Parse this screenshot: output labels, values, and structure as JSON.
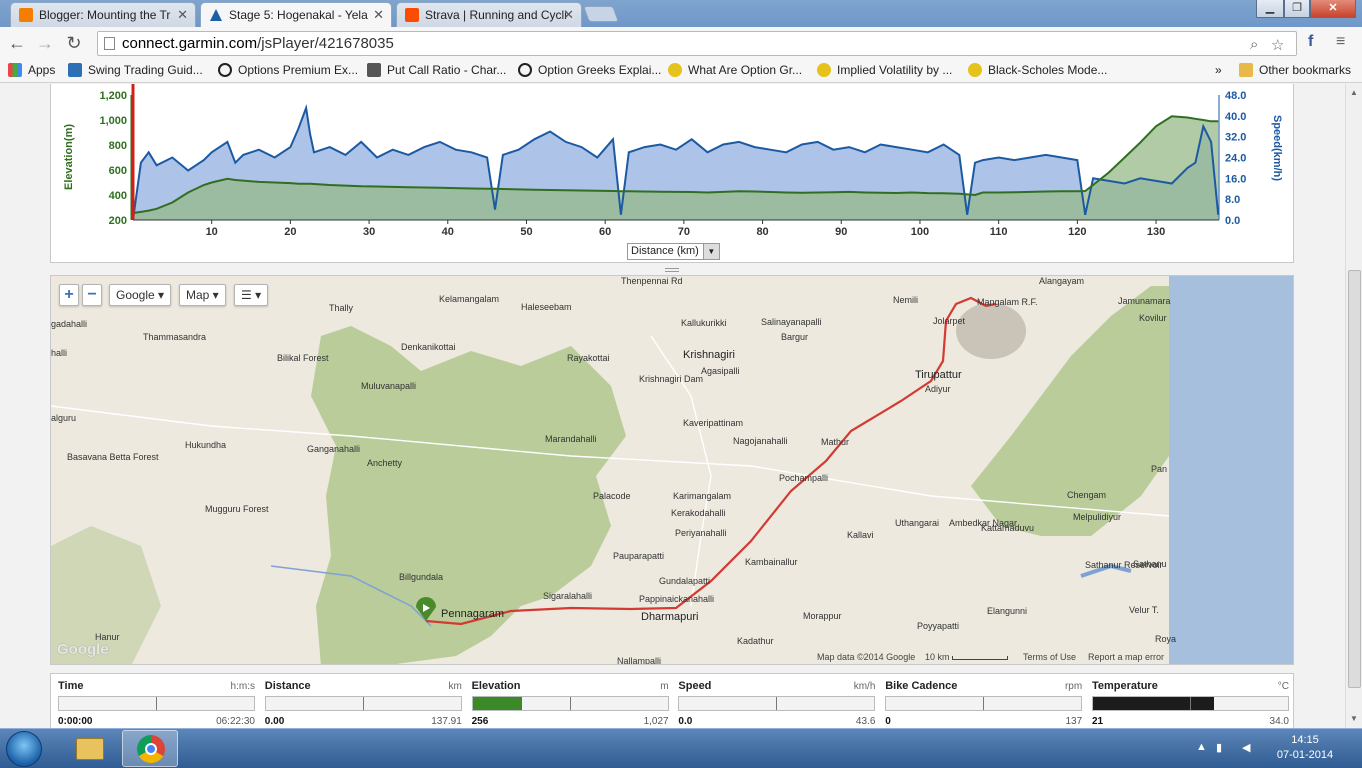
{
  "browser": {
    "tabs": [
      {
        "label": "Blogger: Mounting the Tr",
        "icon": "blogger-icon",
        "color": "#f57d00"
      },
      {
        "label": "Stage 5: Hogenakal - Yela",
        "icon": "garmin-icon",
        "color": "#1a5fa8"
      },
      {
        "label": "Strava | Running and Cycli",
        "icon": "strava-icon",
        "color": "#fc4c02"
      }
    ],
    "url_host": "connect.garmin.com",
    "url_path": "/jsPlayer/421678035",
    "bookmarks": [
      {
        "label": "Apps",
        "icon": "apps-grid-icon"
      },
      {
        "label": "Swing Trading Guid...",
        "icon": "bookmark-page-icon"
      },
      {
        "label": "Options Premium Ex...",
        "icon": "bookmark-o-icon"
      },
      {
        "label": "Put Call Ratio - Char...",
        "icon": "bookmark-chart-icon"
      },
      {
        "label": "Option Greeks Explai...",
        "icon": "bookmark-o-icon"
      },
      {
        "label": "What Are Option Gr...",
        "icon": "bookmark-smiley-icon"
      },
      {
        "label": "Implied Volatility by ...",
        "icon": "bookmark-smiley-icon"
      },
      {
        "label": "Black-Scholes Mode...",
        "icon": "bookmark-smiley-icon"
      }
    ],
    "more_bookmarks": "»",
    "other_bookmarks": "Other bookmarks"
  },
  "chart": {
    "left_axis_title": "Elevation(m)",
    "right_axis_title": "Speed(km/h)",
    "distance_select": "Distance (km)"
  },
  "chart_data": {
    "type": "area",
    "x": [
      0,
      1,
      2,
      3,
      5,
      7,
      9,
      10,
      12,
      13,
      14,
      16,
      18,
      20,
      21,
      22,
      22.5,
      23,
      25,
      27,
      29,
      31,
      33,
      35,
      37,
      39,
      41,
      43,
      45,
      46,
      47,
      49,
      51,
      53,
      55,
      57,
      59,
      61,
      62,
      63,
      65,
      67,
      69,
      71,
      73,
      75,
      77,
      79,
      81,
      83,
      85,
      87,
      89,
      91,
      93,
      95,
      97,
      99,
      101,
      103,
      105,
      106,
      107,
      108,
      110,
      112,
      114,
      116,
      118,
      120,
      121,
      122,
      124,
      126,
      128,
      130,
      132,
      134,
      135,
      136,
      137,
      137.9
    ],
    "xlim": [
      0,
      138
    ],
    "xticks": [
      10,
      20,
      30,
      40,
      50,
      60,
      70,
      80,
      90,
      100,
      110,
      120,
      130
    ],
    "series": [
      {
        "name": "Elevation(m)",
        "unit": "m",
        "color": "#2f6f1f",
        "fill": "#97b98a",
        "values": [
          256,
          265,
          275,
          290,
          340,
          420,
          480,
          500,
          530,
          520,
          515,
          505,
          500,
          495,
          490,
          490,
          490,
          488,
          480,
          475,
          470,
          468,
          465,
          462,
          460,
          458,
          455,
          452,
          450,
          450,
          448,
          445,
          442,
          440,
          438,
          436,
          434,
          432,
          430,
          430,
          428,
          426,
          425,
          424,
          420,
          425,
          430,
          428,
          424,
          420,
          418,
          420,
          422,
          425,
          420,
          418,
          416,
          420,
          415,
          414,
          410,
          405,
          400,
          420,
          420,
          422,
          425,
          428,
          430,
          430,
          432,
          480,
          580,
          700,
          820,
          950,
          1030,
          1020,
          1010,
          1000,
          990,
          990
        ]
      },
      {
        "name": "Speed(km/h)",
        "unit": "km/h",
        "color": "#1b5aa3",
        "fill": "#9fb8e3",
        "values": [
          0,
          22,
          26,
          21,
          24,
          19,
          23,
          26,
          30,
          22,
          25,
          27,
          24,
          28,
          35,
          43,
          33,
          26,
          28,
          25,
          30,
          24,
          27,
          25,
          28,
          30,
          27,
          26,
          24,
          4,
          25,
          27,
          31,
          34,
          30,
          28,
          24,
          31,
          2,
          26,
          28,
          29,
          27,
          31,
          26,
          29,
          30,
          28,
          27,
          26,
          29,
          30,
          27,
          28,
          26,
          29,
          28,
          27,
          26,
          29,
          25,
          2,
          22,
          23,
          24,
          23,
          24,
          25,
          24,
          23,
          2,
          16,
          15,
          14,
          16,
          15,
          14,
          20,
          22,
          36,
          30,
          2
        ]
      }
    ],
    "ylim_left": [
      200,
      1200
    ],
    "yticks_left": [
      "200",
      "400",
      "600",
      "800",
      "1,000",
      "1,200"
    ],
    "ylim_right": [
      0,
      48
    ],
    "yticks_right": [
      "0.0",
      "8.0",
      "16.0",
      "24.0",
      "32.0",
      "40.0",
      "48.0"
    ],
    "xlabel": "Distance (km)",
    "cursor_x": 0
  },
  "map": {
    "zoom_in": "+",
    "zoom_out": "−",
    "provider": "Google",
    "map_type": "Map",
    "layers_icon": "layers-icon",
    "places": [
      {
        "name": "Alangayam",
        "big": false
      },
      {
        "name": "Kelamangalam",
        "big": false
      },
      {
        "name": "Haleseebam",
        "big": false
      },
      {
        "name": "Thally",
        "big": false
      },
      {
        "name": "Kallukurikki",
        "big": false
      },
      {
        "name": "Salinayanapalli",
        "big": false
      },
      {
        "name": "Nemili",
        "big": false
      },
      {
        "name": "Mangalam R.F.",
        "big": false
      },
      {
        "name": "Jamunamara",
        "big": false
      },
      {
        "name": "Kovilur",
        "big": false
      },
      {
        "name": "gadahalli",
        "big": false
      },
      {
        "name": "Thammasandra",
        "big": false
      },
      {
        "name": "Denkanikottai",
        "big": false
      },
      {
        "name": "Rayakottai",
        "big": false
      },
      {
        "name": "Krishnagiri",
        "big": true
      },
      {
        "name": "Bargur",
        "big": false
      },
      {
        "name": "Jolarpet",
        "big": false
      },
      {
        "name": "Bilikal Forest",
        "big": false
      },
      {
        "name": "Agasipalli",
        "big": false
      },
      {
        "name": "Krishnagiri Dam",
        "big": false
      },
      {
        "name": "Muluvanapalli",
        "big": false
      },
      {
        "name": "Tirupattur",
        "big": true
      },
      {
        "name": "Adiyur",
        "big": false
      },
      {
        "name": "halli",
        "big": false
      },
      {
        "name": "alguru",
        "big": false
      },
      {
        "name": "Kaveripattinam",
        "big": false
      },
      {
        "name": "Hukundha",
        "big": false
      },
      {
        "name": "Marandahalli",
        "big": false
      },
      {
        "name": "Nagojanahalli",
        "big": false
      },
      {
        "name": "Mathur",
        "big": false
      },
      {
        "name": "Basavana Betta Forest",
        "big": false
      },
      {
        "name": "Ganganahalli",
        "big": false
      },
      {
        "name": "Anchetty",
        "big": false
      },
      {
        "name": "Pochampalli",
        "big": false
      },
      {
        "name": "Pan",
        "big": false
      },
      {
        "name": "Palacode",
        "big": false
      },
      {
        "name": "Karimangalam",
        "big": false
      },
      {
        "name": "Chengam",
        "big": false
      },
      {
        "name": "Kerakodahalli",
        "big": false
      },
      {
        "name": "Mugguru Forest",
        "big": false
      },
      {
        "name": "Melpulidiyur",
        "big": false
      },
      {
        "name": "Periyanahalli",
        "big": false
      },
      {
        "name": "Uthangarai",
        "big": false
      },
      {
        "name": "Ambedkar Nagar",
        "big": false
      },
      {
        "name": "Kallavi",
        "big": false
      },
      {
        "name": "Kattamaduvu",
        "big": false
      },
      {
        "name": "Pauparapatti",
        "big": false
      },
      {
        "name": "Kambainallur",
        "big": false
      },
      {
        "name": "Sathanur Reservoir",
        "big": false
      },
      {
        "name": "Sathanu",
        "big": false
      },
      {
        "name": "Billgundala",
        "big": false
      },
      {
        "name": "Sigaralahalli",
        "big": false
      },
      {
        "name": "Gundalapatti",
        "big": false
      },
      {
        "name": "Pappinaickanahalli",
        "big": false
      },
      {
        "name": "Elangunni",
        "big": false
      },
      {
        "name": "Velur T.",
        "big": false
      },
      {
        "name": "Pennagaram",
        "big": true
      },
      {
        "name": "Dharmapuri",
        "big": true
      },
      {
        "name": "Morappur",
        "big": false
      },
      {
        "name": "Hanur",
        "big": false
      },
      {
        "name": "Kadathur",
        "big": false
      },
      {
        "name": "Poyyapatti",
        "big": false
      },
      {
        "name": "Roya",
        "big": false
      },
      {
        "name": "Nallampalli",
        "big": false
      },
      {
        "name": "Thenpennai Rd",
        "big": false
      }
    ],
    "footer": {
      "map_data": "Map data ©2014 Google",
      "scale": "10 km",
      "terms": "Terms of Use",
      "report": "Report a map error"
    },
    "google_logo": "Google"
  },
  "stats": [
    {
      "label": "Time",
      "unit": "h:m:s",
      "value": "0:00:00",
      "max": "06:22:30",
      "fill": 0,
      "fill_color": "#3a7a2a"
    },
    {
      "label": "Distance",
      "unit": "km",
      "value": "0.00",
      "max": "137.91",
      "fill": 0,
      "fill_color": "#3a7a2a"
    },
    {
      "label": "Elevation",
      "unit": "m",
      "value": "256",
      "max": "1,027",
      "fill": 0.25,
      "fill_color": "#3a8a2a"
    },
    {
      "label": "Speed",
      "unit": "km/h",
      "value": "0.0",
      "max": "43.6",
      "fill": 0,
      "fill_color": "#3a7a2a"
    },
    {
      "label": "Bike Cadence",
      "unit": "rpm",
      "value": "0",
      "max": "137",
      "fill": 0,
      "fill_color": "#3a7a2a"
    },
    {
      "label": "Temperature",
      "unit": "°C",
      "value": "21",
      "max": "34.0",
      "fill": 0.62,
      "fill_color": "#1c1c1c"
    }
  ],
  "taskbar": {
    "time": "14:15",
    "date": "07-01-2014"
  }
}
